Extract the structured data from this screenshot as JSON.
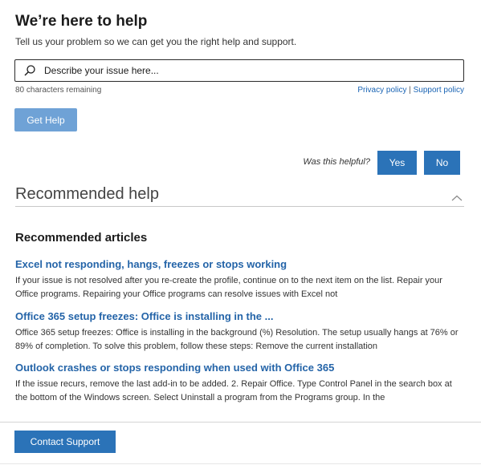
{
  "header": {
    "title": "We’re here to help",
    "subtitle": "Tell us your problem so we can get you the right help and support."
  },
  "search": {
    "placeholder": "Describe your issue here...",
    "value": "",
    "chars_remaining": "80 characters remaining"
  },
  "policies": {
    "privacy": "Privacy policy",
    "separator": " | ",
    "support": "Support policy"
  },
  "actions": {
    "get_help": "Get Help",
    "contact_support": "Contact Support"
  },
  "feedback": {
    "question": "Was this helpful?",
    "yes": "Yes",
    "no": "No"
  },
  "recommended": {
    "section_title": "Recommended help",
    "articles_title": "Recommended articles",
    "articles": [
      {
        "title": "Excel not responding, hangs, freezes or stops working",
        "description": "If your issue is not resolved after you re-create the profile, continue on to the next item on the list. Repair your Office programs. Repairing your Office programs can resolve issues with Excel not"
      },
      {
        "title": "Office 365 setup freezes: Office is installing in the ...",
        "description": "Office 365 setup freezes: Office is installing in the background (%) Resolution. The setup usually hangs at 76% or 89% of completion. To solve this problem, follow these steps: Remove the current installation"
      },
      {
        "title": "Outlook crashes or stops responding when used with Office 365",
        "description": "If the issue recurs, remove the last add-in to be added. 2. Repair Office. Type Control Panel in the search box at the bottom of the Windows screen. Select Uninstall a program from the Programs group. In the"
      }
    ]
  },
  "icons": {
    "search": "search-icon",
    "collapse": "chevron-up-icon"
  },
  "colors": {
    "accent": "#2b73b8",
    "accent_disabled": "#6fa2d6",
    "link": "#2464a8"
  }
}
